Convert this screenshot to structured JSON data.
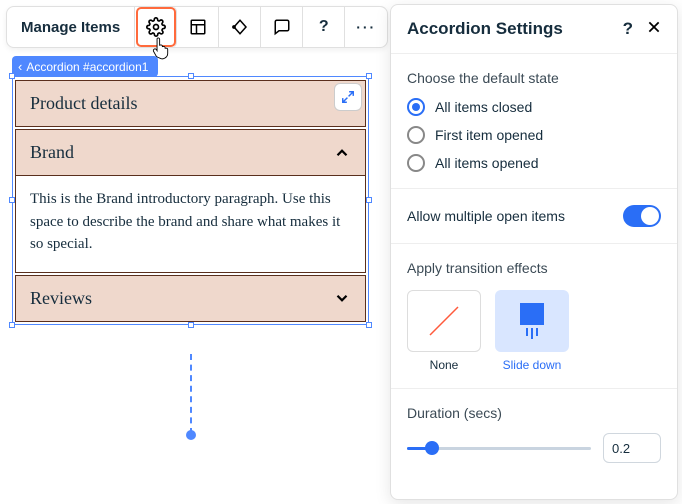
{
  "toolbar": {
    "manage_label": "Manage Items"
  },
  "breadcrumb": "Accordion #accordion1",
  "accordion": {
    "items": [
      {
        "title": "Product details"
      },
      {
        "title": "Brand",
        "body": "This is the Brand introductory paragraph. Use this space to describe the brand and share what makes it so special."
      },
      {
        "title": "Reviews"
      }
    ]
  },
  "panel": {
    "title": "Accordion Settings",
    "default_state": {
      "section_label": "Choose the default state",
      "options": [
        "All items closed",
        "First item opened",
        "All items opened"
      ],
      "selected": 0
    },
    "allow_multiple_label": "Allow multiple open items",
    "transition": {
      "section_label": "Apply transition effects",
      "options": {
        "none": "None",
        "slide": "Slide down"
      },
      "selected": "slide"
    },
    "duration": {
      "label": "Duration (secs)",
      "value": "0.2"
    }
  }
}
